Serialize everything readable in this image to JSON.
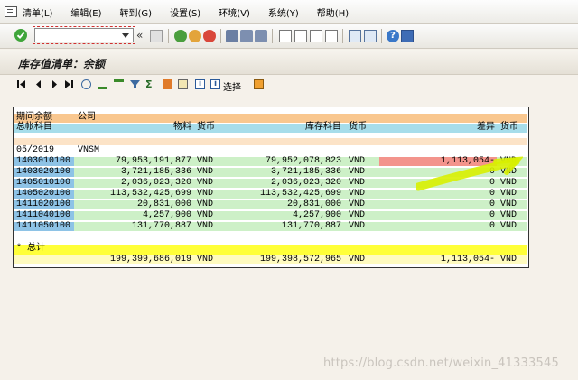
{
  "menu": [
    "清单(L)",
    "编辑(E)",
    "转到(G)",
    "设置(S)",
    "环境(V)",
    "系统(Y)",
    "帮助(H)"
  ],
  "command_field": {
    "value": ""
  },
  "page_title": "库存值清单：余额",
  "app_toolbar": {
    "select_label": "选择"
  },
  "report": {
    "hdr1": {
      "period": "期间余额",
      "company": "公司"
    },
    "hdr2": {
      "gl_account": "总帐科目",
      "material": "物料",
      "currency1": "货币",
      "stock_account": "库存科目",
      "currency2": "货币",
      "diff": "差异",
      "currency3": "货币"
    },
    "period_row": {
      "period": "05/2019",
      "company": "VNSM"
    },
    "rows": [
      {
        "acct": "1403010100",
        "material": "79,953,191,877",
        "cur1": "VND",
        "stock": "79,952,078,823",
        "cur2": "VND",
        "diff": "1,113,054-",
        "cur3": "VND"
      },
      {
        "acct": "1403020100",
        "material": "3,721,185,336",
        "cur1": "VND",
        "stock": "3,721,185,336",
        "cur2": "VND",
        "diff": "0",
        "cur3": "VND"
      },
      {
        "acct": "1405010100",
        "material": "2,036,023,320",
        "cur1": "VND",
        "stock": "2,036,023,320",
        "cur2": "VND",
        "diff": "0",
        "cur3": "VND"
      },
      {
        "acct": "1405020100",
        "material": "113,532,425,699",
        "cur1": "VND",
        "stock": "113,532,425,699",
        "cur2": "VND",
        "diff": "0",
        "cur3": "VND"
      },
      {
        "acct": "1411020100",
        "material": "20,831,000",
        "cur1": "VND",
        "stock": "20,831,000",
        "cur2": "VND",
        "diff": "0",
        "cur3": "VND"
      },
      {
        "acct": "1411040100",
        "material": "4,257,900",
        "cur1": "VND",
        "stock": "4,257,900",
        "cur2": "VND",
        "diff": "0",
        "cur3": "VND"
      },
      {
        "acct": "1411050100",
        "material": "131,770,887",
        "cur1": "VND",
        "stock": "131,770,887",
        "cur2": "VND",
        "diff": "0",
        "cur3": "VND"
      }
    ],
    "total_label": "* 总计",
    "total": {
      "material": "199,399,686,019",
      "cur1": "VND",
      "stock": "199,398,572,965",
      "cur2": "VND",
      "diff": "1,113,054-",
      "cur3": "VND"
    }
  },
  "watermark": "https://blog.csdn.net/weixin_41333545",
  "colors": {
    "header_orange": "#f9c78f",
    "header_cyan": "#a7ddea",
    "key_blue": "#8ec3e6",
    "row_green": "#cdf0c7",
    "diff_red": "#f3948c",
    "total_yellow": "#ffff38",
    "total_row": "#fffbbf",
    "highlighter": "#d8f000"
  }
}
